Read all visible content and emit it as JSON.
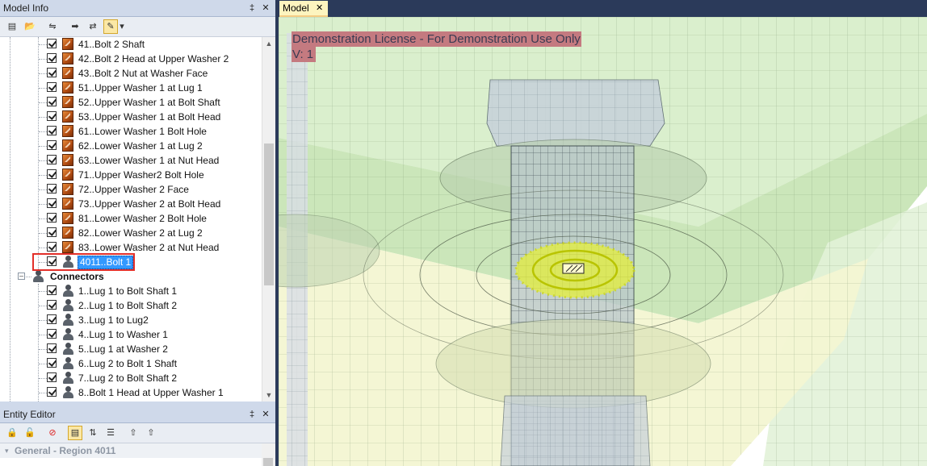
{
  "model_info": {
    "title": "Model Info",
    "pin": "‡",
    "close": "✕",
    "tree_items": [
      {
        "label": "41..Bolt 2 Shaft",
        "kind": "region"
      },
      {
        "label": "42..Bolt 2 Head at Upper Washer 2",
        "kind": "region"
      },
      {
        "label": "43..Bolt 2 Nut at Washer Face",
        "kind": "region"
      },
      {
        "label": "51..Upper Washer 1 at Lug 1",
        "kind": "region"
      },
      {
        "label": "52..Upper Washer 1 at Bolt Shaft",
        "kind": "region"
      },
      {
        "label": "53..Upper Washer 1 at Bolt Head",
        "kind": "region"
      },
      {
        "label": "61..Lower Washer 1 Bolt Hole",
        "kind": "region"
      },
      {
        "label": "62..Lower Washer 1 at Lug 2",
        "kind": "region"
      },
      {
        "label": "63..Lower Washer 1 at Nut Head",
        "kind": "region"
      },
      {
        "label": "71..Upper Washer2 Bolt Hole",
        "kind": "region"
      },
      {
        "label": "72..Upper Washer 2 Face",
        "kind": "region"
      },
      {
        "label": "73..Upper Washer 2 at Bolt Head",
        "kind": "region"
      },
      {
        "label": "81..Lower Washer 2 Bolt Hole",
        "kind": "region"
      },
      {
        "label": "82..Lower Washer 2 at Lug 2",
        "kind": "region"
      },
      {
        "label": "83..Lower Washer 2 at Nut Head",
        "kind": "region"
      },
      {
        "label": "4011..Bolt 1",
        "kind": "selected"
      }
    ],
    "connectors_group": "Connectors",
    "connector_items": [
      "1..Lug 1 to Bolt Shaft 1",
      "2..Lug 1 to Bolt Shaft 2",
      "3..Lug 1 to Lug2",
      "4..Lug 1 to Washer 1",
      "5..Lug 1 at Washer 2",
      "6..Lug 2 to Bolt 1 Shaft",
      "7..Lug 2 to Bolt Shaft 2",
      "8..Bolt 1 Head at Upper Washer 1"
    ]
  },
  "entity_editor": {
    "title": "Entity Editor",
    "category": "General - Region 4011"
  },
  "model_tab": {
    "label": "Model",
    "close": "✕"
  },
  "viewport": {
    "license_line1": "Demonstration License - For Demonstration Use Only",
    "license_line2": "V: 1"
  }
}
